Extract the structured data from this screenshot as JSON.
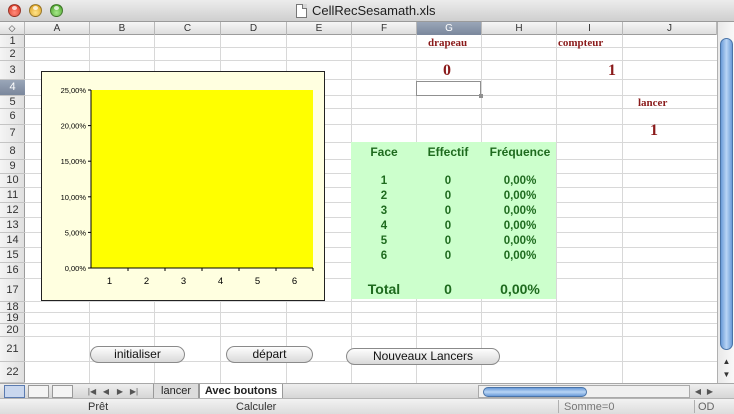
{
  "window": {
    "title": "CellRecSesamath.xls"
  },
  "corner": {
    "symbol": "◇"
  },
  "columns": [
    {
      "label": "A",
      "selected": false
    },
    {
      "label": "B",
      "selected": false
    },
    {
      "label": "C",
      "selected": false
    },
    {
      "label": "D",
      "selected": false
    },
    {
      "label": "E",
      "selected": false
    },
    {
      "label": "F",
      "selected": false
    },
    {
      "label": "G",
      "selected": true
    },
    {
      "label": "H",
      "selected": false
    },
    {
      "label": "I",
      "selected": false
    },
    {
      "label": "J",
      "selected": false
    }
  ],
  "rows": [
    {
      "label": "1",
      "selected": false
    },
    {
      "label": "2",
      "selected": false
    },
    {
      "label": "3",
      "selected": false
    },
    {
      "label": "4",
      "selected": true
    },
    {
      "label": "5",
      "selected": false
    },
    {
      "label": "6",
      "selected": false
    },
    {
      "label": "7",
      "selected": false
    },
    {
      "label": "8",
      "selected": false
    },
    {
      "label": "9",
      "selected": false
    },
    {
      "label": "10",
      "selected": false
    },
    {
      "label": "11",
      "selected": false
    },
    {
      "label": "12",
      "selected": false
    },
    {
      "label": "13",
      "selected": false
    },
    {
      "label": "14",
      "selected": false
    },
    {
      "label": "15",
      "selected": false
    },
    {
      "label": "16",
      "selected": false
    },
    {
      "label": "17",
      "selected": false
    },
    {
      "label": "18",
      "selected": false
    },
    {
      "label": "19",
      "selected": false
    },
    {
      "label": "20",
      "selected": false
    },
    {
      "label": "21",
      "selected": false
    },
    {
      "label": "22",
      "selected": false
    }
  ],
  "cells": {
    "drapeau_label": "drapeau",
    "drapeau_value": "0",
    "compteur_label": "compteur",
    "compteur_value": "1",
    "lancer_label": "lancer",
    "lancer_value": "1"
  },
  "stats": {
    "headers": [
      "Face",
      "Effectif",
      "Fréquence"
    ],
    "rows": [
      [
        "1",
        "0",
        "0,00%"
      ],
      [
        "2",
        "0",
        "0,00%"
      ],
      [
        "3",
        "0",
        "0,00%"
      ],
      [
        "4",
        "0",
        "0,00%"
      ],
      [
        "5",
        "0",
        "0,00%"
      ],
      [
        "6",
        "0",
        "0,00%"
      ]
    ],
    "total": [
      "Total",
      "0",
      "0,00%"
    ]
  },
  "chart_data": {
    "type": "bar",
    "categories": [
      "1",
      "2",
      "3",
      "4",
      "5",
      "6"
    ],
    "values": [
      0,
      0,
      0,
      0,
      0,
      0
    ],
    "yticks": [
      "0,00%",
      "5,00%",
      "10,00%",
      "15,00%",
      "20,00%",
      "25,00%"
    ],
    "ylim": [
      0,
      25
    ],
    "title": "",
    "xlabel": "",
    "ylabel": "",
    "grid": false,
    "colors": {
      "plot_area": "#ffff00",
      "chart_area": "#ffffe0"
    }
  },
  "buttons": {
    "initialiser": "initialiser",
    "depart": "départ",
    "nouveaux": "Nouveaux Lancers"
  },
  "sheets": [
    {
      "label": "lancer",
      "active": false
    },
    {
      "label": "Avec boutons",
      "active": true
    }
  ],
  "nav": {
    "first": "|◀",
    "prev": "◀",
    "next": "▶",
    "last": "▶|"
  },
  "scroll": {
    "up": "▲",
    "down": "▼",
    "left": "◀",
    "right": "▶"
  },
  "status": {
    "ready": "Prêt",
    "calc": "Calculer",
    "sum": "Somme=0",
    "mode": "OD"
  },
  "colors": {
    "label_red": "#8a1a1a",
    "stats_green_bg": "#ccffcc",
    "stats_green_text": "#1e6b1e",
    "selection_blue": "#7a879c"
  }
}
